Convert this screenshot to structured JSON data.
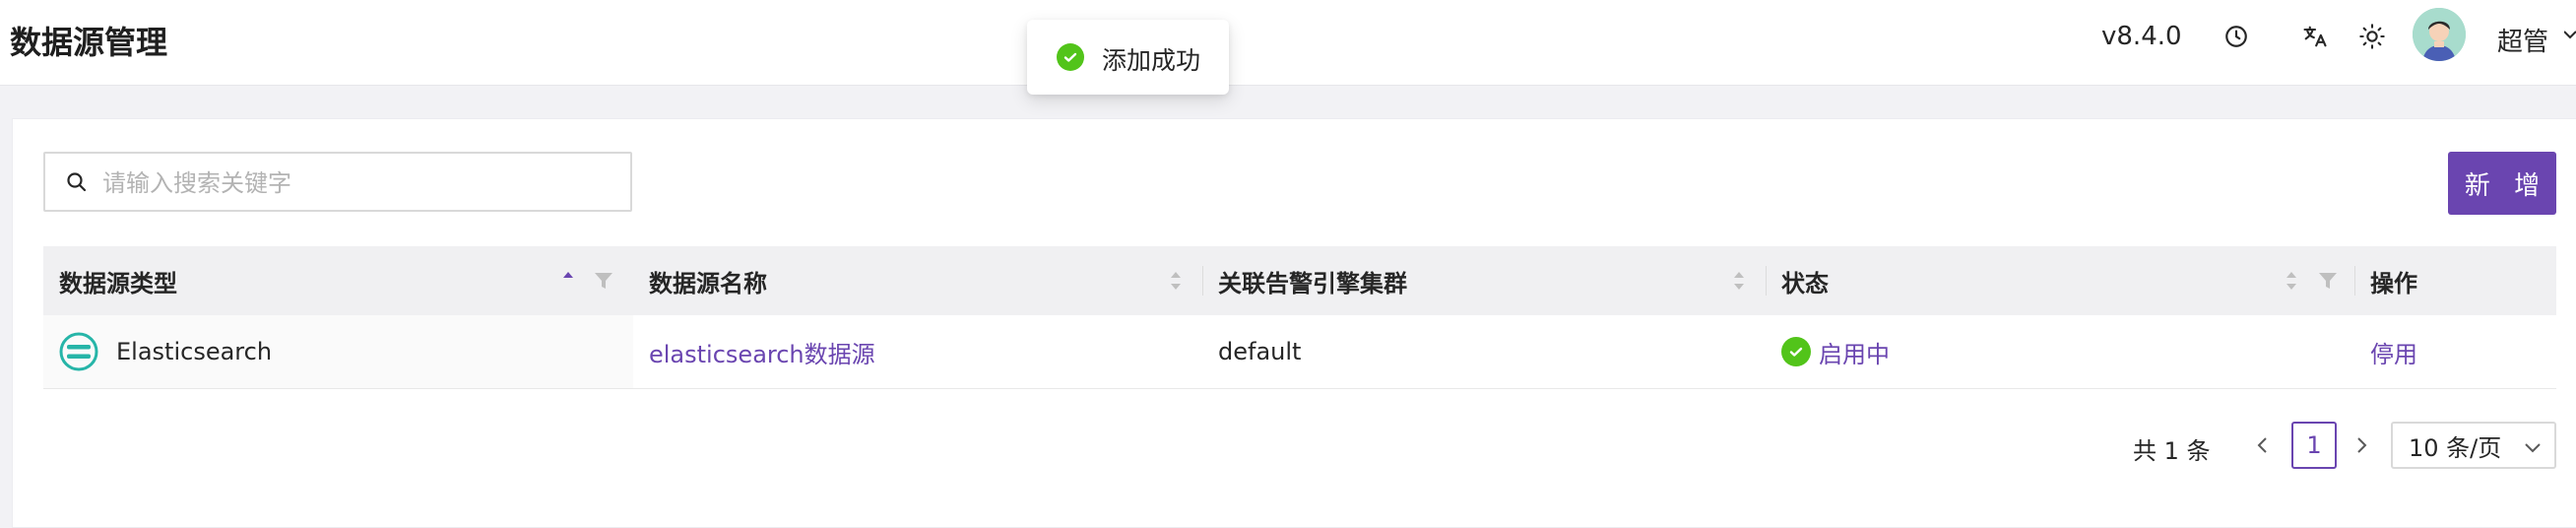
{
  "header": {
    "title": "数据源管理",
    "version": "v8.4.0",
    "username": "超管",
    "icons": [
      "history-icon",
      "translate-icon",
      "theme-sun-icon",
      "avatar",
      "chevron-down-icon"
    ]
  },
  "toast": {
    "text": "添加成功",
    "icon": "success-check-icon",
    "color": "#52c41a"
  },
  "search": {
    "placeholder": "请输入搜索关键字",
    "value": ""
  },
  "toolbar": {
    "add_label": "新 增"
  },
  "table": {
    "columns": [
      "数据源类型",
      "数据源名称",
      "关联告警引擎集群",
      "状态",
      "操作"
    ],
    "rows": [
      {
        "type": "Elasticsearch",
        "type_icon": "elasticsearch-logo-icon",
        "name": "elasticsearch数据源",
        "cluster": "default",
        "status": "启用中",
        "action": "停用"
      }
    ]
  },
  "pagination": {
    "total": "共 1 条",
    "current_page": "1",
    "page_size": "10 条/页"
  },
  "colors": {
    "accent": "#6a45b0",
    "success": "#52c41a"
  }
}
